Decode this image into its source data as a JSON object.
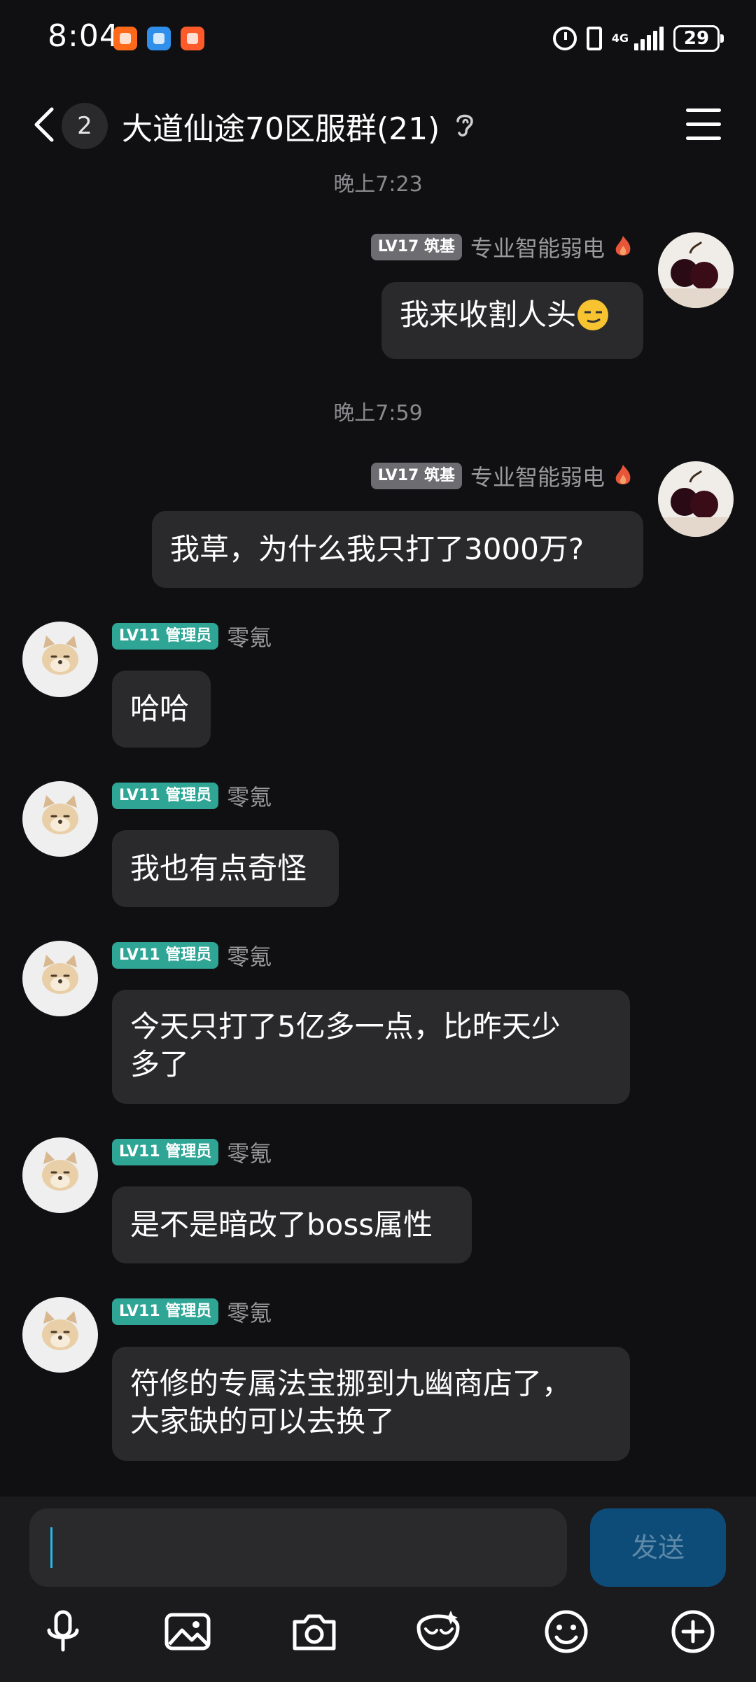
{
  "status_bar": {
    "time": "8:04",
    "network": "4G",
    "battery": "29"
  },
  "header": {
    "unread_count": "2",
    "title": "大道仙途70区服群(21)"
  },
  "messages": [
    {
      "time": "晚上7:23",
      "level": "LV17 筑基",
      "nick": "专业智能弱电",
      "text": "我来收割人头"
    },
    {
      "time": "晚上7:59",
      "level": "LV17 筑基",
      "nick": "专业智能弱电",
      "text": "我草，为什么我只打了3000万?"
    },
    {
      "level": "LV11 管理员",
      "nick": "零氪",
      "text": "哈哈"
    },
    {
      "level": "LV11 管理员",
      "nick": "零氪",
      "text": "我也有点奇怪"
    },
    {
      "level": "LV11 管理员",
      "nick": "零氪",
      "text_line1": "今天只打了5亿多一点，比昨天少",
      "text_line2": "多了"
    },
    {
      "level": "LV11 管理员",
      "nick": "零氪",
      "text": "是不是暗改了boss属性"
    },
    {
      "level": "LV11 管理员",
      "nick": "零氪",
      "text_line1": "符修的专属法宝挪到九幽商店了，",
      "text_line2": "大家缺的可以去换了"
    }
  ],
  "composer": {
    "input_value": "",
    "send_label": "发送"
  },
  "icons": [
    "microphone-icon",
    "image-icon",
    "camera-icon",
    "red-packet-icon",
    "emoji-icon",
    "plus-icon"
  ],
  "colors": {
    "background": "#101012",
    "bubble": "#2a2a2d",
    "admin_tag": "#2fa596",
    "level_tag": "#6d6d71",
    "send_button": "#0d4c78",
    "cursor": "#27b6e8"
  }
}
